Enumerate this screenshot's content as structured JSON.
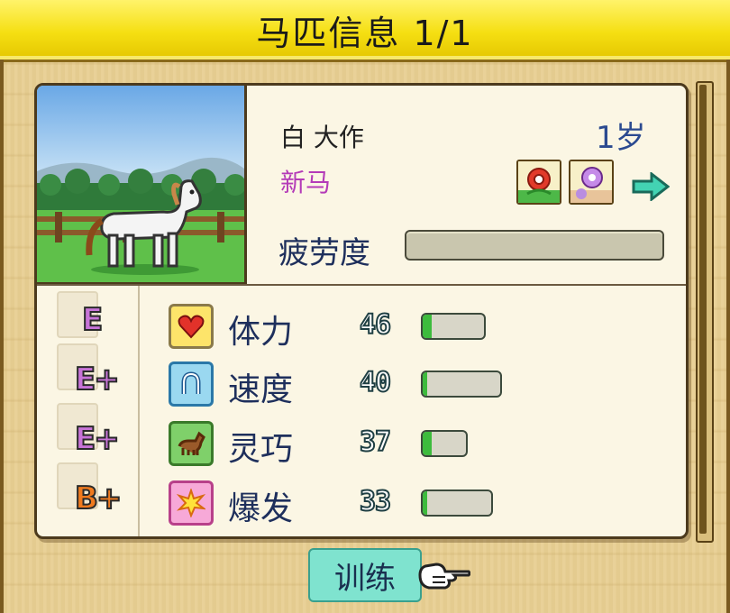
{
  "title": "马匹信息 1/1",
  "horse": {
    "name": "白 大作",
    "age": "1岁",
    "status": "新马",
    "fatigue_label": "疲劳度",
    "fatigue_level": 0.0
  },
  "badges": [
    "rose-badge-icon",
    "purple-flower-badge-icon"
  ],
  "stats": [
    {
      "label": "体力",
      "value": "46",
      "grade": "E",
      "grade_color": "#c874d8",
      "icon": "heart-icon",
      "fill": 0.15,
      "bar": "wide"
    },
    {
      "label": "速度",
      "value": "40",
      "grade": "E+",
      "grade_color": "#c874d8",
      "icon": "horseshoe-icon",
      "fill": 0.06,
      "bar": "wider"
    },
    {
      "label": "灵巧",
      "value": "37",
      "grade": "E+",
      "grade_color": "#c874d8",
      "icon": "horse-icon",
      "fill": 0.2,
      "bar": "short"
    },
    {
      "label": "爆发",
      "value": "33",
      "grade": "B+",
      "grade_color": "#f07a1e",
      "icon": "burst-icon",
      "fill": 0.07,
      "bar": "wide"
    }
  ],
  "train_button": "训练"
}
